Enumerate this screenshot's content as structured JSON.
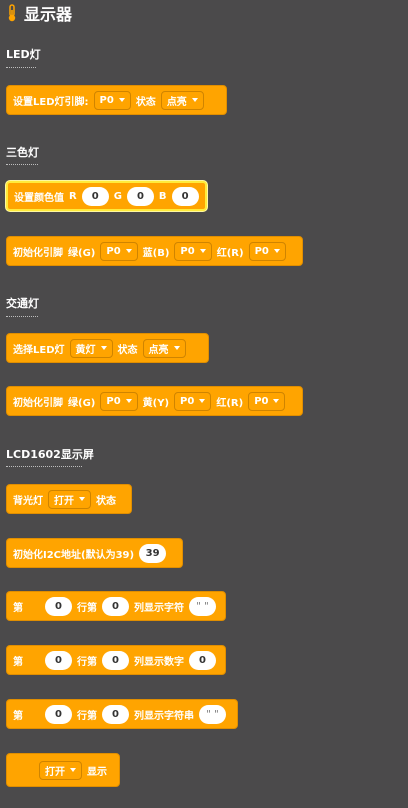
{
  "header": {
    "title": "显示器"
  },
  "sections": {
    "led": "LED灯",
    "rgb": "三色灯",
    "traffic": "交通灯",
    "lcd": "LCD1602显示屏"
  },
  "led_block": {
    "label": "设置LED灯引脚:",
    "pin": "P0",
    "state_label": "状态",
    "state": "点亮"
  },
  "rgb_set_block": {
    "label": "设置颜色值",
    "r_label": "R",
    "r": "0",
    "g_label": "G",
    "g": "0",
    "b_label": "B",
    "b": "0"
  },
  "rgb_init_block": {
    "label": "初始化引脚",
    "green_label": "绿(G)",
    "green_pin": "P0",
    "blue_label": "蓝(B)",
    "blue_pin": "P0",
    "red_label": "红(R)",
    "red_pin": "P0"
  },
  "traffic_select_block": {
    "label": "选择LED灯",
    "light": "黄灯",
    "state_label": "状态",
    "state": "点亮"
  },
  "traffic_init_block": {
    "label": "初始化引脚",
    "green_label": "绿(G)",
    "green_pin": "P0",
    "yellow_label": "黄(Y)",
    "yellow_pin": "P0",
    "red_label": "红(R)",
    "red_pin": "P0"
  },
  "backlight_block": {
    "label": "背光灯",
    "value": "打开",
    "state_label": "状态"
  },
  "i2c_block": {
    "label": "初始化I2C地址(默认为39)",
    "value": "39"
  },
  "lcd_char_block": {
    "prefix": "第",
    "row": "0",
    "row_label": "行第",
    "col": "0",
    "suffix": "列显示字符",
    "text": "\" \""
  },
  "lcd_num_block": {
    "prefix": "第",
    "row": "0",
    "row_label": "行第",
    "col": "0",
    "suffix": "列显示数字",
    "value": "0"
  },
  "lcd_str_block": {
    "prefix": "第",
    "row": "0",
    "row_label": "行第",
    "col": "0",
    "suffix": "列显示字符串",
    "text": "\" \""
  },
  "display_block": {
    "value": "打开",
    "label": "显示"
  },
  "colors": {
    "block": "#ffa400",
    "block_border": "#e08e00",
    "background": "#4b4a4b",
    "selected_outline": "#ffeb3b"
  }
}
